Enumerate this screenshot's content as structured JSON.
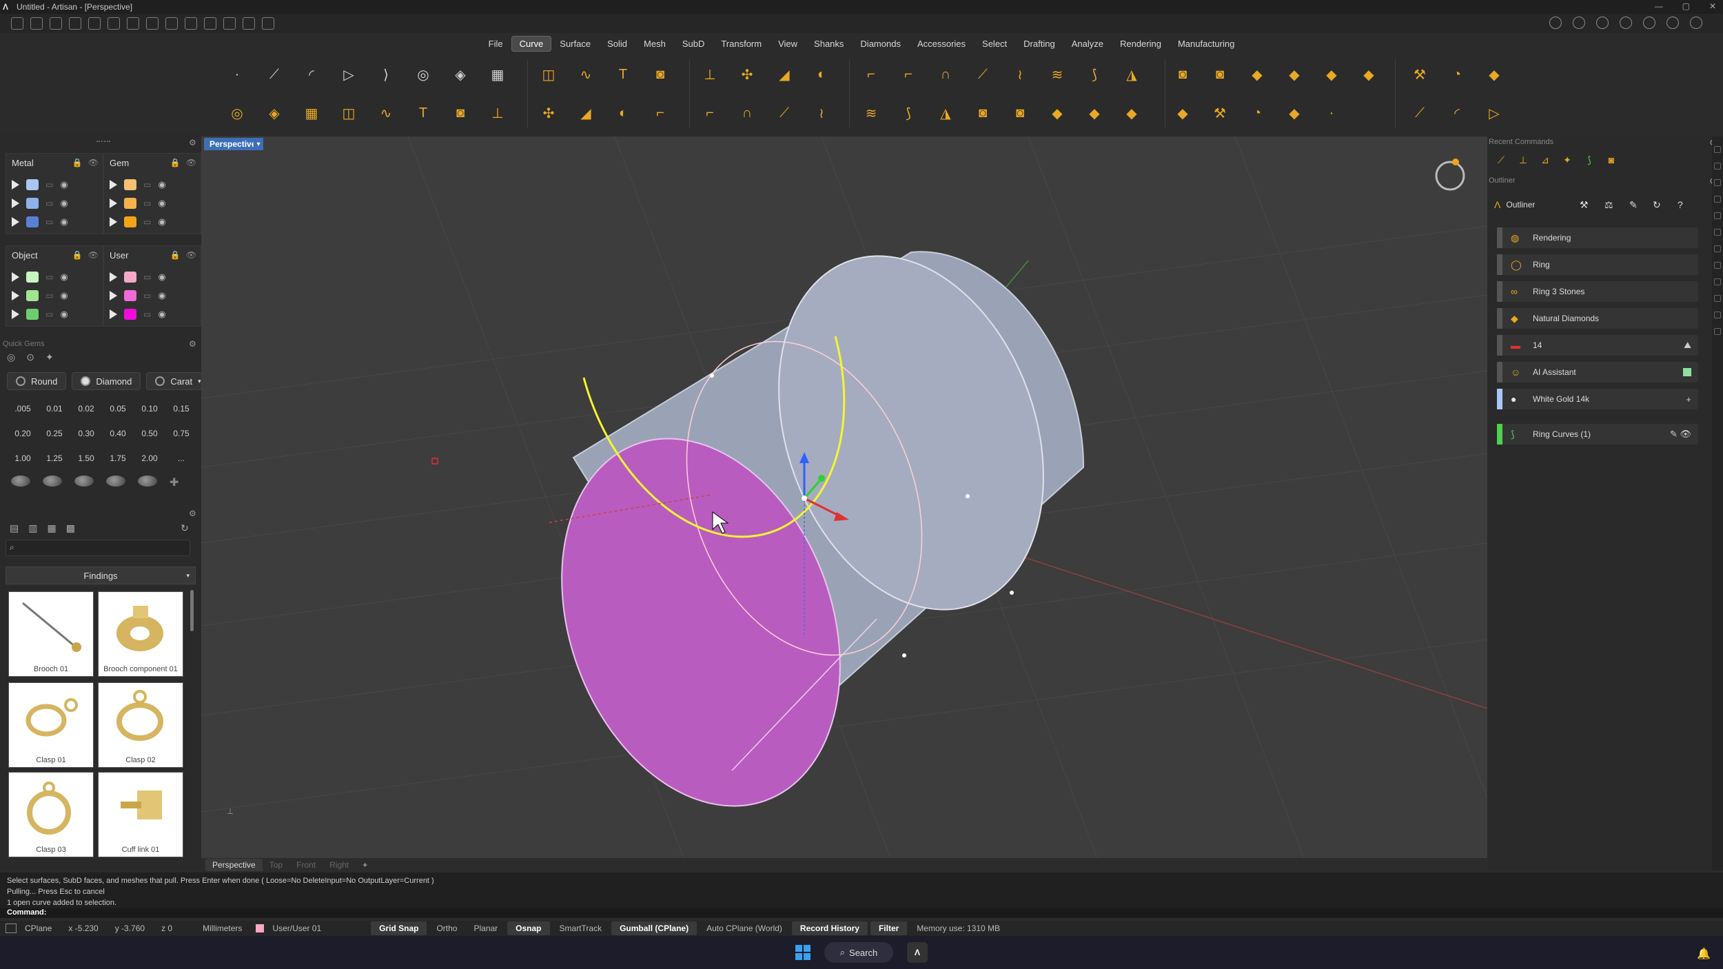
{
  "window": {
    "title": "Untitled - Artisan - [Perspective]"
  },
  "menu": [
    "File",
    "Curve",
    "Surface",
    "Solid",
    "Mesh",
    "SubD",
    "Transform",
    "View",
    "Shanks",
    "Diamonds",
    "Accessories",
    "Select",
    "Drafting",
    "Analyze",
    "Rendering",
    "Manufacturing"
  ],
  "menu_active": "Curve",
  "layers": {
    "metal": {
      "label": "Metal",
      "colors": [
        "#a9c6f5",
        "#8fb2ee",
        "#5a80d6"
      ]
    },
    "gem": {
      "label": "Gem",
      "colors": [
        "#f5c070",
        "#f3b34a",
        "#f2a514"
      ]
    },
    "object": {
      "label": "Object",
      "colors": [
        "#c8f4c0",
        "#9fe68f",
        "#6ccf6c"
      ]
    },
    "user": {
      "label": "User",
      "colors": [
        "#f5a8c8",
        "#f26ad6",
        "#f20bdc"
      ]
    }
  },
  "quick_gems": {
    "title": "Quick Gems",
    "cuts": [
      {
        "label": "Round"
      },
      {
        "label": "Diamond"
      },
      {
        "label": "Carat"
      }
    ],
    "rows": [
      [
        ".005",
        "0.01",
        "0.02",
        "0.05",
        "0.10",
        "0.15"
      ],
      [
        "0.20",
        "0.25",
        "0.30",
        "0.40",
        "0.50",
        "0.75"
      ],
      [
        "1.00",
        "1.25",
        "1.50",
        "1.75",
        "2.00",
        "..."
      ]
    ]
  },
  "library": {
    "category": "Findings",
    "items": [
      {
        "label": "Brooch 01"
      },
      {
        "label": "Brooch component 01"
      },
      {
        "label": "Clasp 01"
      },
      {
        "label": "Clasp 02"
      },
      {
        "label": "Clasp 03"
      },
      {
        "label": "Cuff link 01"
      }
    ]
  },
  "viewport": {
    "active_tab": "Perspective",
    "tabs": [
      "Perspective",
      "Top",
      "Front",
      "Right"
    ],
    "add_tab": "+"
  },
  "recent_commands": {
    "title": "Recent Commands"
  },
  "outliner": {
    "section_title": "Outliner",
    "header": "Outliner",
    "items": [
      {
        "label": "Rendering",
        "bar": "#555555",
        "icon": "render-icon"
      },
      {
        "label": "Ring",
        "bar": "#555555",
        "icon": "ring-icon"
      },
      {
        "label": "Ring 3 Stones",
        "bar": "#555555",
        "icon": "stones-icon"
      },
      {
        "label": "Natural Diamonds",
        "bar": "#555555",
        "icon": "diamond-icon"
      },
      {
        "label": "14",
        "bar": "#555555",
        "icon": "flag-icon"
      },
      {
        "label": "AI Assistant",
        "bar": "#555555",
        "icon": "assistant-icon"
      },
      {
        "label": "White Gold 14k",
        "bar": "#a9c6f5",
        "icon": "material-icon"
      },
      {
        "label": "Ring Curves (1)",
        "bar": "#4fd04f",
        "icon": "curve-icon"
      }
    ]
  },
  "command_history": [
    "Select surfaces, SubD faces, and meshes that pull. Press Enter when done ( Loose=No  DeleteInput=No  OutputLayer=Current )",
    "Pulling... Press Esc to cancel",
    "1 open curve added to selection."
  ],
  "command_prompt": "Command:",
  "status": {
    "cplane": "CPlane",
    "x": "x -5.230",
    "y": "y -3.760",
    "z": "z 0",
    "units": "Millimeters",
    "layer": "User/User 01",
    "toggles": [
      {
        "label": "Grid Snap",
        "on": true
      },
      {
        "label": "Ortho",
        "on": false
      },
      {
        "label": "Planar",
        "on": false
      },
      {
        "label": "Osnap",
        "on": true
      },
      {
        "label": "SmartTrack",
        "on": false
      },
      {
        "label": "Gumball (CPlane)",
        "on": true
      },
      {
        "label": "Auto CPlane (World)",
        "on": false
      },
      {
        "label": "Record History",
        "on": true
      },
      {
        "label": "Filter",
        "on": true
      }
    ],
    "memory": "Memory use: 1310 MB"
  },
  "taskbar": {
    "search": "Search"
  }
}
